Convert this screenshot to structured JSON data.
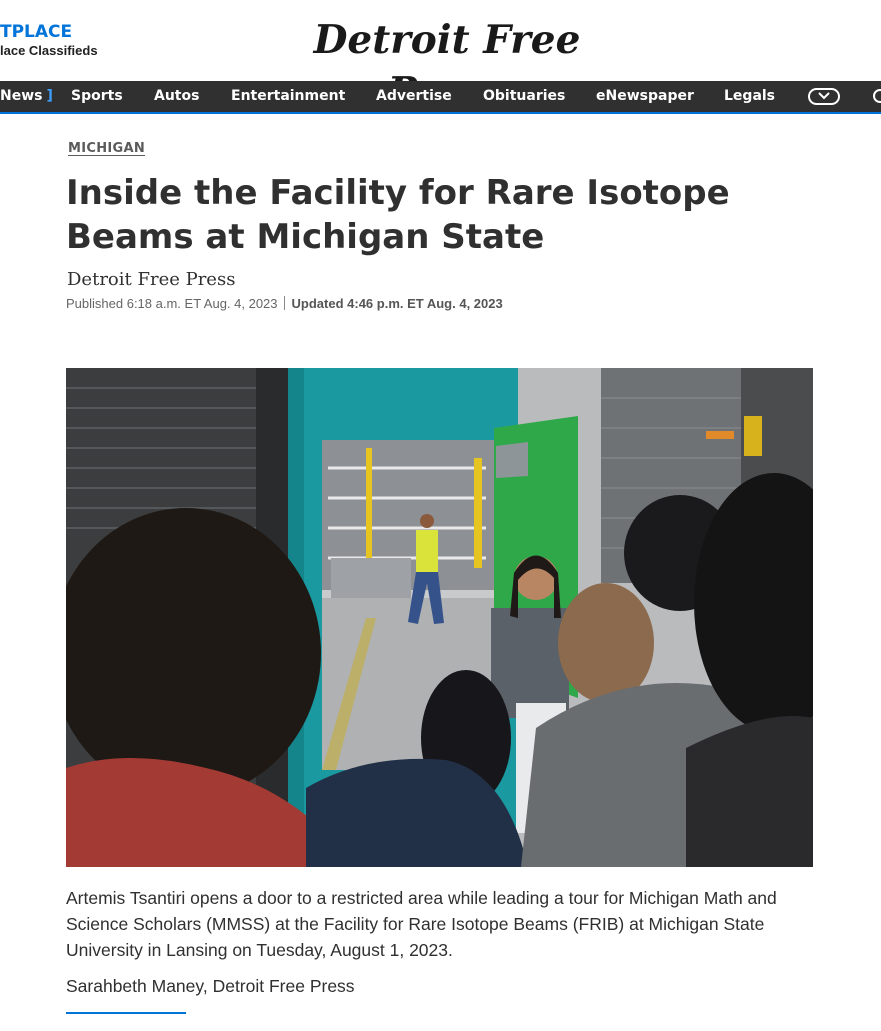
{
  "header": {
    "marketplace_title": "TPLACE",
    "marketplace_sub": "lace Classifieds",
    "logo_text": "Detroit Free Press"
  },
  "nav": {
    "items": [
      "News",
      "Sports",
      "Autos",
      "Entertainment",
      "Advertise",
      "Obituaries",
      "eNewspaper",
      "Legals"
    ],
    "active_marker": "]",
    "more_icon": "chevron-down-icon",
    "search_icon": "search-icon"
  },
  "article": {
    "section": "MICHIGAN",
    "headline": "Inside the Facility for Rare Isotope Beams at Michigan State",
    "byline": "Detroit Free Press",
    "published": "Published 6:18 a.m. ET Aug. 4, 2023",
    "updated": "Updated 4:46 p.m. ET Aug. 4, 2023",
    "caption": "Artemis Tsantiri opens a door to a restricted area while leading a tour for Michigan Math and Science Scholars (MMSS) at the Facility for Rare Isotope Beams (FRIB) at Michigan State University in Lansing on Tuesday, August 1, 2023.",
    "credit": "Sarahbeth Maney, Detroit Free Press"
  },
  "colors": {
    "accent": "#0074d9",
    "nav_bg": "#303030",
    "door_teal": "#1a9aa0",
    "door_green": "#2fa84a"
  }
}
